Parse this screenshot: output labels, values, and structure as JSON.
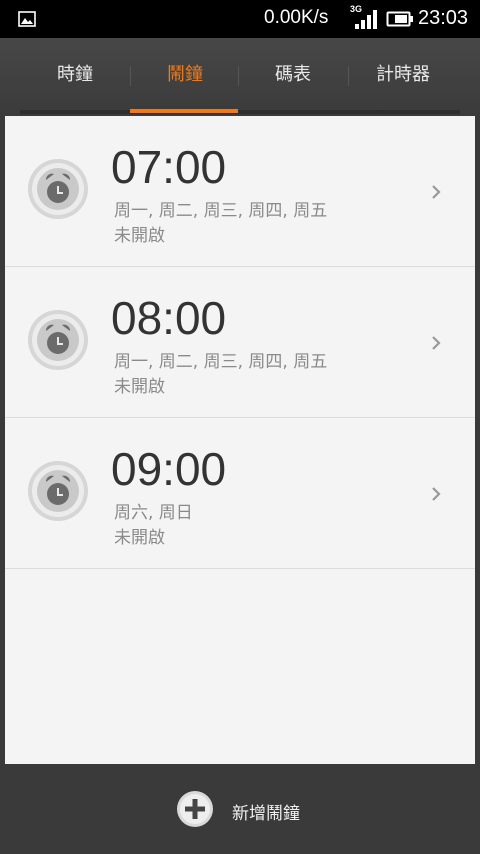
{
  "status_bar": {
    "net_speed": "0.00K/s",
    "network_type": "3G",
    "time": "23:03"
  },
  "tabs": [
    {
      "label": "時鐘",
      "active": false
    },
    {
      "label": "鬧鐘",
      "active": true
    },
    {
      "label": "碼表",
      "active": false
    },
    {
      "label": "計時器",
      "active": false
    }
  ],
  "alarms": [
    {
      "time": "07:00",
      "days": "周一, 周二, 周三, 周四, 周五",
      "status": "未開啟"
    },
    {
      "time": "08:00",
      "days": "周一, 周二, 周三, 周四, 周五",
      "status": "未開啟"
    },
    {
      "time": "09:00",
      "days": "周六, 周日",
      "status": "未開啟"
    }
  ],
  "footer": {
    "add_label": "新增鬧鐘"
  },
  "colors": {
    "accent": "#f07a14",
    "background": "#3a3a3a",
    "list_background": "#f4f4f4"
  },
  "icons": {
    "alarm": "alarm-clock-icon",
    "chevron": "chevron-right-icon",
    "add": "plus-circle-icon"
  }
}
